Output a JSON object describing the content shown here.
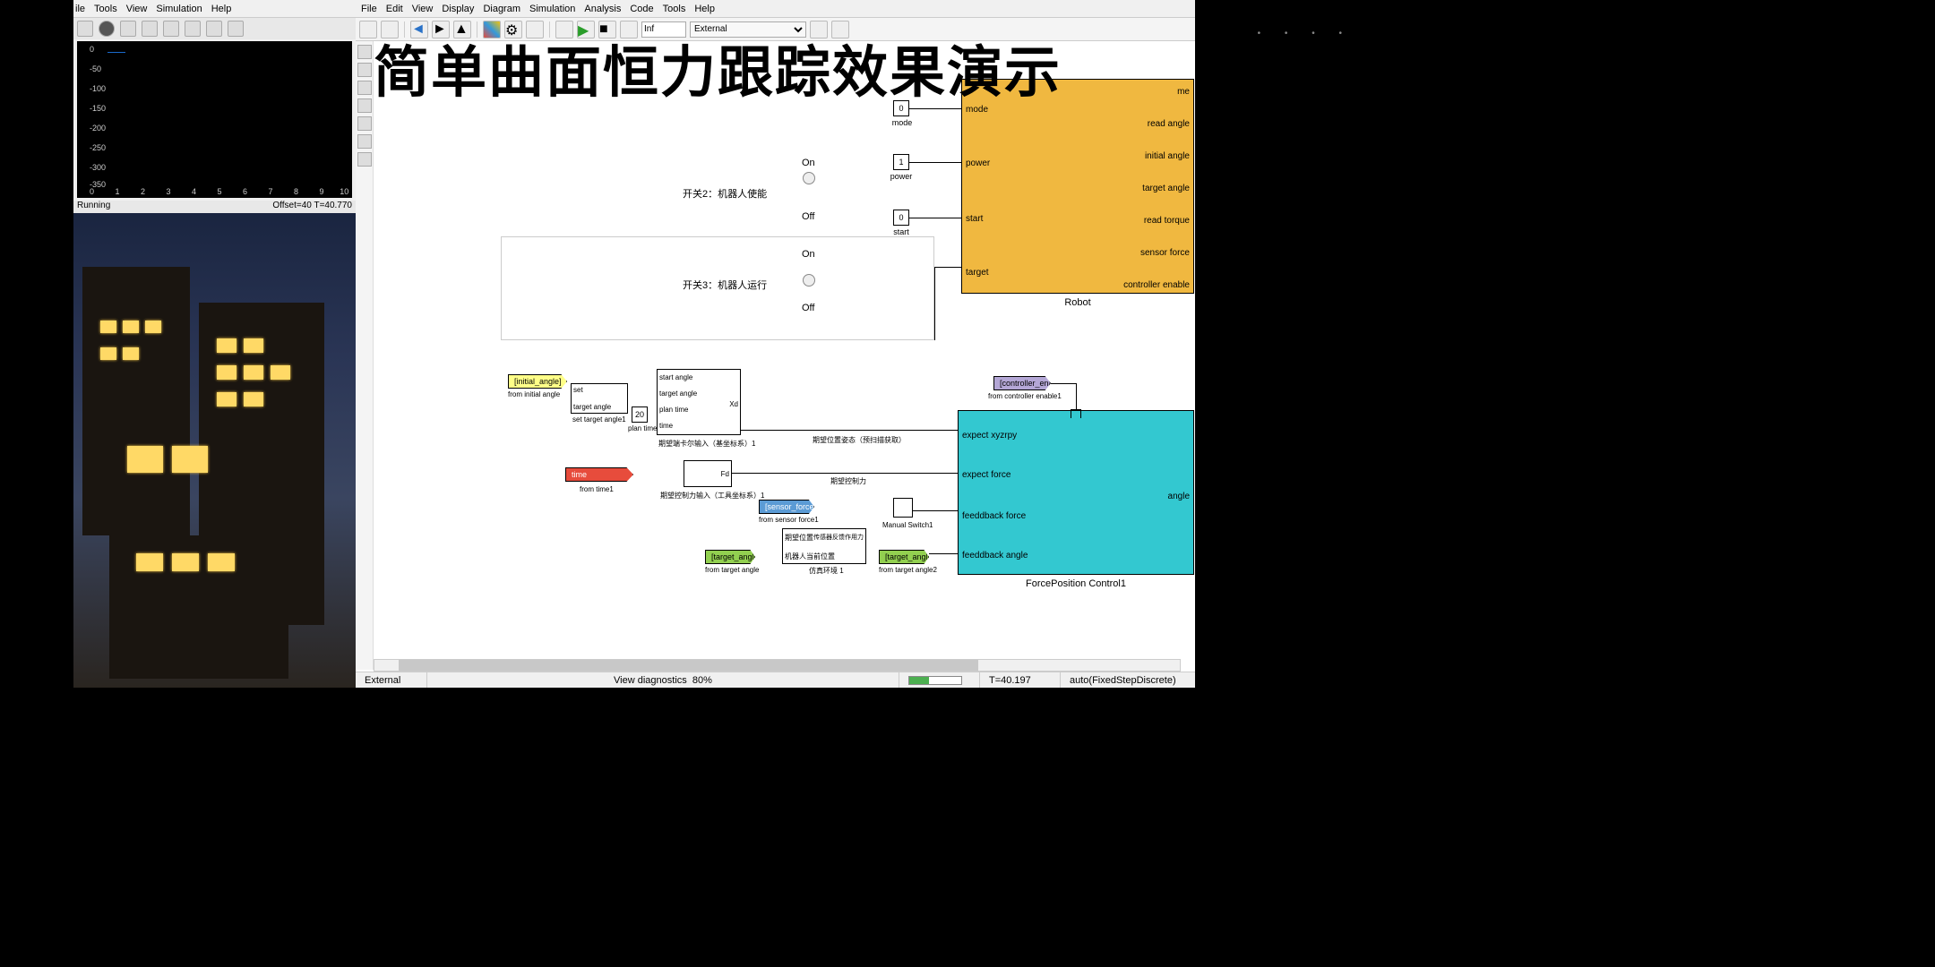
{
  "title_overlay": "简单曲面恒力跟踪效果演示",
  "scope": {
    "menus": [
      "ile",
      "Tools",
      "View",
      "Simulation",
      "Help"
    ],
    "status_left": "Running",
    "status_right": "Offset=40  T=40.770",
    "y_ticks": [
      "0",
      "-50",
      "-100",
      "-150",
      "-200",
      "-250",
      "-300",
      "-350"
    ],
    "x_ticks": [
      "0",
      "1",
      "2",
      "3",
      "4",
      "5",
      "6",
      "7",
      "8",
      "9",
      "10"
    ]
  },
  "simulink": {
    "menus": [
      "File",
      "Edit",
      "View",
      "Display",
      "Diagram",
      "Simulation",
      "Analysis",
      "Code",
      "Tools",
      "Help"
    ],
    "stop_time": "Inf",
    "mode": "External",
    "status_mode": "External",
    "status_view": "View diagnostics",
    "status_zoom": "80%",
    "status_time": "T=40.197",
    "status_solver": "auto(FixedStepDiscrete)",
    "progress_pct": 38
  },
  "switches": {
    "s2": {
      "label": "开关2：机器人使能",
      "on": "On",
      "off": "Off"
    },
    "s3": {
      "label": "开关3：机器人运行",
      "on": "On",
      "off": "Off"
    }
  },
  "constants": {
    "mode": {
      "value": "0",
      "label": "mode"
    },
    "power": {
      "value": "1",
      "label": "power"
    },
    "start": {
      "value": "0",
      "label": "start"
    },
    "plan_time": {
      "value": "20",
      "label": "plan time"
    }
  },
  "robot_block": {
    "title": "Robot",
    "ports_left": [
      "mode",
      "power",
      "start",
      "target"
    ],
    "ports_right": [
      "me",
      "read angle",
      "initial angle",
      "target angle",
      "read torque",
      "sensor force",
      "controller enable"
    ]
  },
  "fpc_block": {
    "title": "ForcePosition Control1",
    "ports_left": [
      "expect xyzrpy",
      "expect force",
      "feeddback force",
      "feeddback angle"
    ],
    "ports_right": [
      "angle"
    ]
  },
  "tags": {
    "initial_angle": "[initial_angle]",
    "initial_angle_from": "from initial angle",
    "time1": "time",
    "time1_from": "from time1",
    "sensor_force": "[sensor_force]",
    "sensor_force_from": "from sensor force1",
    "target_angle": "[target_angle]",
    "target_angle_from": "from target angle",
    "target_angle2_from": "from target angle2",
    "controller_enable": "[controller_enable]",
    "controller_enable_from": "from controller enable1"
  },
  "small_blocks": {
    "set_target": "set target angle1",
    "set": "set",
    "target_angle_port": "target angle",
    "start_angle": "start angle",
    "p_target_angle": "target angle",
    "p_plan_time": "plan time",
    "p_time": "time",
    "xd_label": "Xd",
    "expect_input": "期望端卡尔输入（基坐标系）1",
    "fd_label": "Fd",
    "expect_force_input": "期望控制力输入（工具坐标系）1",
    "expect_pos_note": "期望位置姿态（预扫描获取）",
    "expect_force_note": "期望控制力",
    "manual_switch": "Manual Switch1",
    "expect_pos": "期望位置",
    "sensor_feedback": "传感器反馈作用力",
    "robot_feedback": "机器人当前位置",
    "sim_loop": "仿真环境 1"
  },
  "right_dots": "•  •  •  •"
}
